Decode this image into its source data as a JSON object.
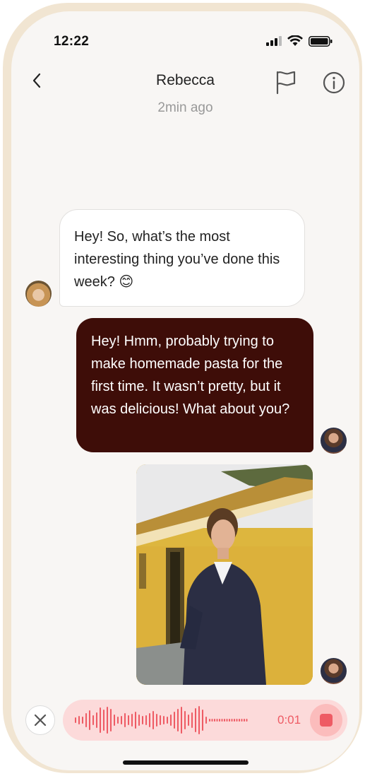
{
  "status_bar": {
    "time": "12:22"
  },
  "header": {
    "title": "Rebecca",
    "last_seen": "2min ago"
  },
  "messages": [
    {
      "sender": "Rebecca",
      "direction": "incoming",
      "text": "Hey! So, what’s the most interesting thing you’ve done this week? 😊"
    },
    {
      "sender": "me",
      "direction": "outgoing",
      "text": "Hey! Hmm, probably trying to make homemade pasta for the first time. It wasn’t pretty, but it was delicious! What about you?"
    },
    {
      "sender": "me",
      "direction": "outgoing",
      "type": "photo"
    }
  ],
  "recording": {
    "elapsed": "0:01"
  },
  "colors": {
    "outgoing_bubble": "#3e0d08",
    "incoming_bubble": "#ffffff",
    "record_bar": "#fcdada",
    "accent": "#ee5b64",
    "frame": "#f1e5d2",
    "background": "#f8f6f4"
  },
  "icons": {
    "back": "chevron-left-icon",
    "report": "flag-icon",
    "info": "info-icon",
    "cancel": "close-icon",
    "stop": "stop-icon"
  }
}
